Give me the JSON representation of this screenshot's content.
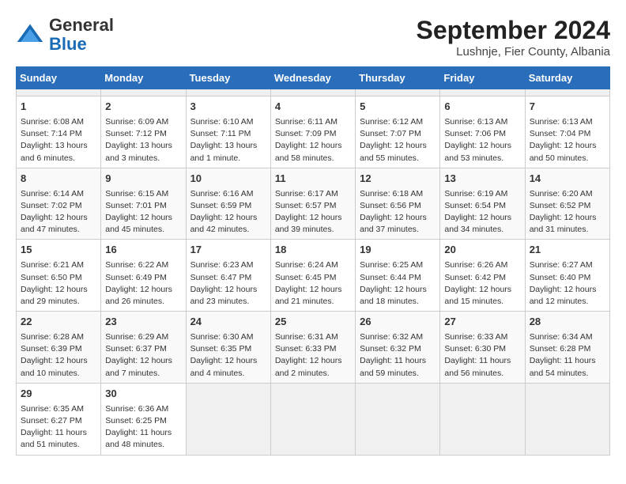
{
  "header": {
    "logo_general": "General",
    "logo_blue": "Blue",
    "month_year": "September 2024",
    "location": "Lushnje, Fier County, Albania"
  },
  "calendar": {
    "days_of_week": [
      "Sunday",
      "Monday",
      "Tuesday",
      "Wednesday",
      "Thursday",
      "Friday",
      "Saturday"
    ],
    "weeks": [
      [
        {
          "day": "",
          "empty": true
        },
        {
          "day": "",
          "empty": true
        },
        {
          "day": "",
          "empty": true
        },
        {
          "day": "",
          "empty": true
        },
        {
          "day": "",
          "empty": true
        },
        {
          "day": "",
          "empty": true
        },
        {
          "day": "",
          "empty": true
        }
      ],
      [
        {
          "day": "1",
          "info": "Sunrise: 6:08 AM\nSunset: 7:14 PM\nDaylight: 13 hours and 6 minutes."
        },
        {
          "day": "2",
          "info": "Sunrise: 6:09 AM\nSunset: 7:12 PM\nDaylight: 13 hours and 3 minutes."
        },
        {
          "day": "3",
          "info": "Sunrise: 6:10 AM\nSunset: 7:11 PM\nDaylight: 13 hours and 1 minute."
        },
        {
          "day": "4",
          "info": "Sunrise: 6:11 AM\nSunset: 7:09 PM\nDaylight: 12 hours and 58 minutes."
        },
        {
          "day": "5",
          "info": "Sunrise: 6:12 AM\nSunset: 7:07 PM\nDaylight: 12 hours and 55 minutes."
        },
        {
          "day": "6",
          "info": "Sunrise: 6:13 AM\nSunset: 7:06 PM\nDaylight: 12 hours and 53 minutes."
        },
        {
          "day": "7",
          "info": "Sunrise: 6:13 AM\nSunset: 7:04 PM\nDaylight: 12 hours and 50 minutes."
        }
      ],
      [
        {
          "day": "8",
          "info": "Sunrise: 6:14 AM\nSunset: 7:02 PM\nDaylight: 12 hours and 47 minutes."
        },
        {
          "day": "9",
          "info": "Sunrise: 6:15 AM\nSunset: 7:01 PM\nDaylight: 12 hours and 45 minutes."
        },
        {
          "day": "10",
          "info": "Sunrise: 6:16 AM\nSunset: 6:59 PM\nDaylight: 12 hours and 42 minutes."
        },
        {
          "day": "11",
          "info": "Sunrise: 6:17 AM\nSunset: 6:57 PM\nDaylight: 12 hours and 39 minutes."
        },
        {
          "day": "12",
          "info": "Sunrise: 6:18 AM\nSunset: 6:56 PM\nDaylight: 12 hours and 37 minutes."
        },
        {
          "day": "13",
          "info": "Sunrise: 6:19 AM\nSunset: 6:54 PM\nDaylight: 12 hours and 34 minutes."
        },
        {
          "day": "14",
          "info": "Sunrise: 6:20 AM\nSunset: 6:52 PM\nDaylight: 12 hours and 31 minutes."
        }
      ],
      [
        {
          "day": "15",
          "info": "Sunrise: 6:21 AM\nSunset: 6:50 PM\nDaylight: 12 hours and 29 minutes."
        },
        {
          "day": "16",
          "info": "Sunrise: 6:22 AM\nSunset: 6:49 PM\nDaylight: 12 hours and 26 minutes."
        },
        {
          "day": "17",
          "info": "Sunrise: 6:23 AM\nSunset: 6:47 PM\nDaylight: 12 hours and 23 minutes."
        },
        {
          "day": "18",
          "info": "Sunrise: 6:24 AM\nSunset: 6:45 PM\nDaylight: 12 hours and 21 minutes."
        },
        {
          "day": "19",
          "info": "Sunrise: 6:25 AM\nSunset: 6:44 PM\nDaylight: 12 hours and 18 minutes."
        },
        {
          "day": "20",
          "info": "Sunrise: 6:26 AM\nSunset: 6:42 PM\nDaylight: 12 hours and 15 minutes."
        },
        {
          "day": "21",
          "info": "Sunrise: 6:27 AM\nSunset: 6:40 PM\nDaylight: 12 hours and 12 minutes."
        }
      ],
      [
        {
          "day": "22",
          "info": "Sunrise: 6:28 AM\nSunset: 6:39 PM\nDaylight: 12 hours and 10 minutes."
        },
        {
          "day": "23",
          "info": "Sunrise: 6:29 AM\nSunset: 6:37 PM\nDaylight: 12 hours and 7 minutes."
        },
        {
          "day": "24",
          "info": "Sunrise: 6:30 AM\nSunset: 6:35 PM\nDaylight: 12 hours and 4 minutes."
        },
        {
          "day": "25",
          "info": "Sunrise: 6:31 AM\nSunset: 6:33 PM\nDaylight: 12 hours and 2 minutes."
        },
        {
          "day": "26",
          "info": "Sunrise: 6:32 AM\nSunset: 6:32 PM\nDaylight: 11 hours and 59 minutes."
        },
        {
          "day": "27",
          "info": "Sunrise: 6:33 AM\nSunset: 6:30 PM\nDaylight: 11 hours and 56 minutes."
        },
        {
          "day": "28",
          "info": "Sunrise: 6:34 AM\nSunset: 6:28 PM\nDaylight: 11 hours and 54 minutes."
        }
      ],
      [
        {
          "day": "29",
          "info": "Sunrise: 6:35 AM\nSunset: 6:27 PM\nDaylight: 11 hours and 51 minutes."
        },
        {
          "day": "30",
          "info": "Sunrise: 6:36 AM\nSunset: 6:25 PM\nDaylight: 11 hours and 48 minutes."
        },
        {
          "day": "",
          "empty": true
        },
        {
          "day": "",
          "empty": true
        },
        {
          "day": "",
          "empty": true
        },
        {
          "day": "",
          "empty": true
        },
        {
          "day": "",
          "empty": true
        }
      ]
    ]
  }
}
